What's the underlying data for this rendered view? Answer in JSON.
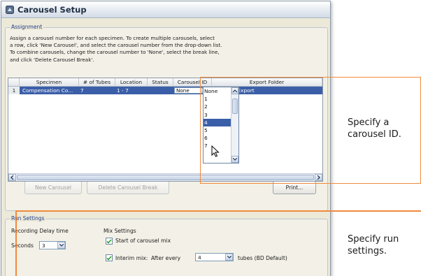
{
  "window": {
    "title": "Carousel Setup"
  },
  "assignment": {
    "legend": "Assignment",
    "instructions": [
      "Assign a carousel number for each specimen.  To create multiple carousels, select",
      "a row, click 'New Carousel', and select the carousel number from the drop-down list.",
      "To combine carousels, change the carousel number to 'None', select the break line,",
      "and click 'Delete Carousel Break'."
    ],
    "columns": [
      "Specimen",
      "# of Tubes",
      "Location",
      "Status",
      "Carousel ID",
      "Export Folder"
    ],
    "rows": [
      {
        "num": "1",
        "specimen": "Compensation Co...",
        "tubes": "7",
        "location": "1 - 7",
        "status": "",
        "carousel_id": "None",
        "export_folder": "D:\\BDExport"
      }
    ],
    "carousel_options": [
      "None",
      "1",
      "2",
      "3",
      "4",
      "5",
      "6",
      "7"
    ],
    "highlighted_option": "4",
    "buttons": {
      "new_carousel": "New Carousel",
      "delete_break": "Delete Carousel Break",
      "print": "Print..."
    }
  },
  "run_settings": {
    "legend": "Run Settings",
    "recording_delay_label": "Recording Delay time",
    "seconds_label": "Seconds",
    "seconds_value": "3",
    "mix_settings_label": "Mix Settings",
    "start_mix_label": "Start of carousel mix",
    "start_mix_checked": true,
    "interim_mix_label": "Interim mix:",
    "after_every_label": "After every",
    "interim_value": "4",
    "tubes_label": "tubes (BD Default)",
    "interim_checked": true
  },
  "callouts": {
    "carousel_id": [
      "Specify a",
      "carousel ID."
    ],
    "run_settings": [
      "Specify run",
      "settings."
    ]
  },
  "colors": {
    "accent": "#f08a3c",
    "selection": "#3b5ea8",
    "title": "#1f2f44"
  }
}
